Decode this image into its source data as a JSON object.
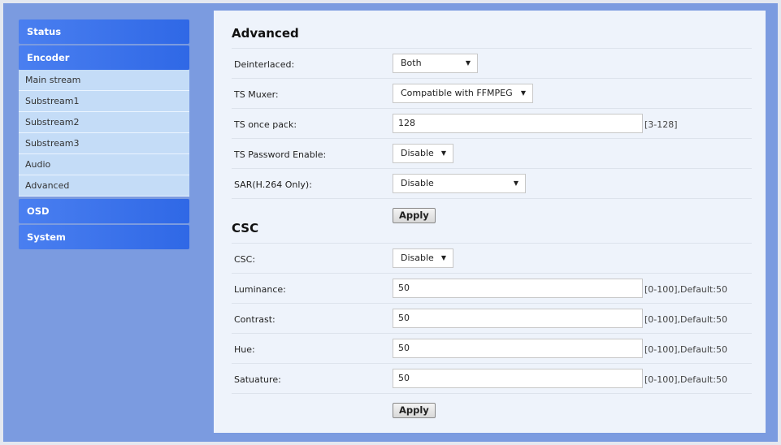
{
  "sidebar": {
    "status": "Status",
    "encoder": "Encoder",
    "items": [
      "Main stream",
      "Substream1",
      "Substream2",
      "Substream3",
      "Audio",
      "Advanced"
    ],
    "osd": "OSD",
    "system": "System"
  },
  "advanced": {
    "title": "Advanced",
    "deinterlaced": {
      "label": "Deinterlaced:",
      "value": "Both"
    },
    "ts_muxer": {
      "label": "TS Muxer:",
      "value": "Compatible with FFMPEG"
    },
    "ts_once_pack": {
      "label": "TS once pack:",
      "value": "128",
      "hint": "[3-128]"
    },
    "ts_password": {
      "label": "TS Password Enable:",
      "value": "Disable"
    },
    "sar": {
      "label": "SAR(H.264 Only):",
      "value": "Disable"
    },
    "apply": "Apply"
  },
  "csc": {
    "title": "CSC",
    "csc": {
      "label": "CSC:",
      "value": "Disable"
    },
    "luminance": {
      "label": "Luminance:",
      "value": "50",
      "hint": "[0-100],Default:50"
    },
    "contrast": {
      "label": "Contrast:",
      "value": "50",
      "hint": "[0-100],Default:50"
    },
    "hue": {
      "label": "Hue:",
      "value": "50",
      "hint": "[0-100],Default:50"
    },
    "saturation": {
      "label": "Satuature:",
      "value": "50",
      "hint": "[0-100],Default:50"
    },
    "apply": "Apply"
  }
}
